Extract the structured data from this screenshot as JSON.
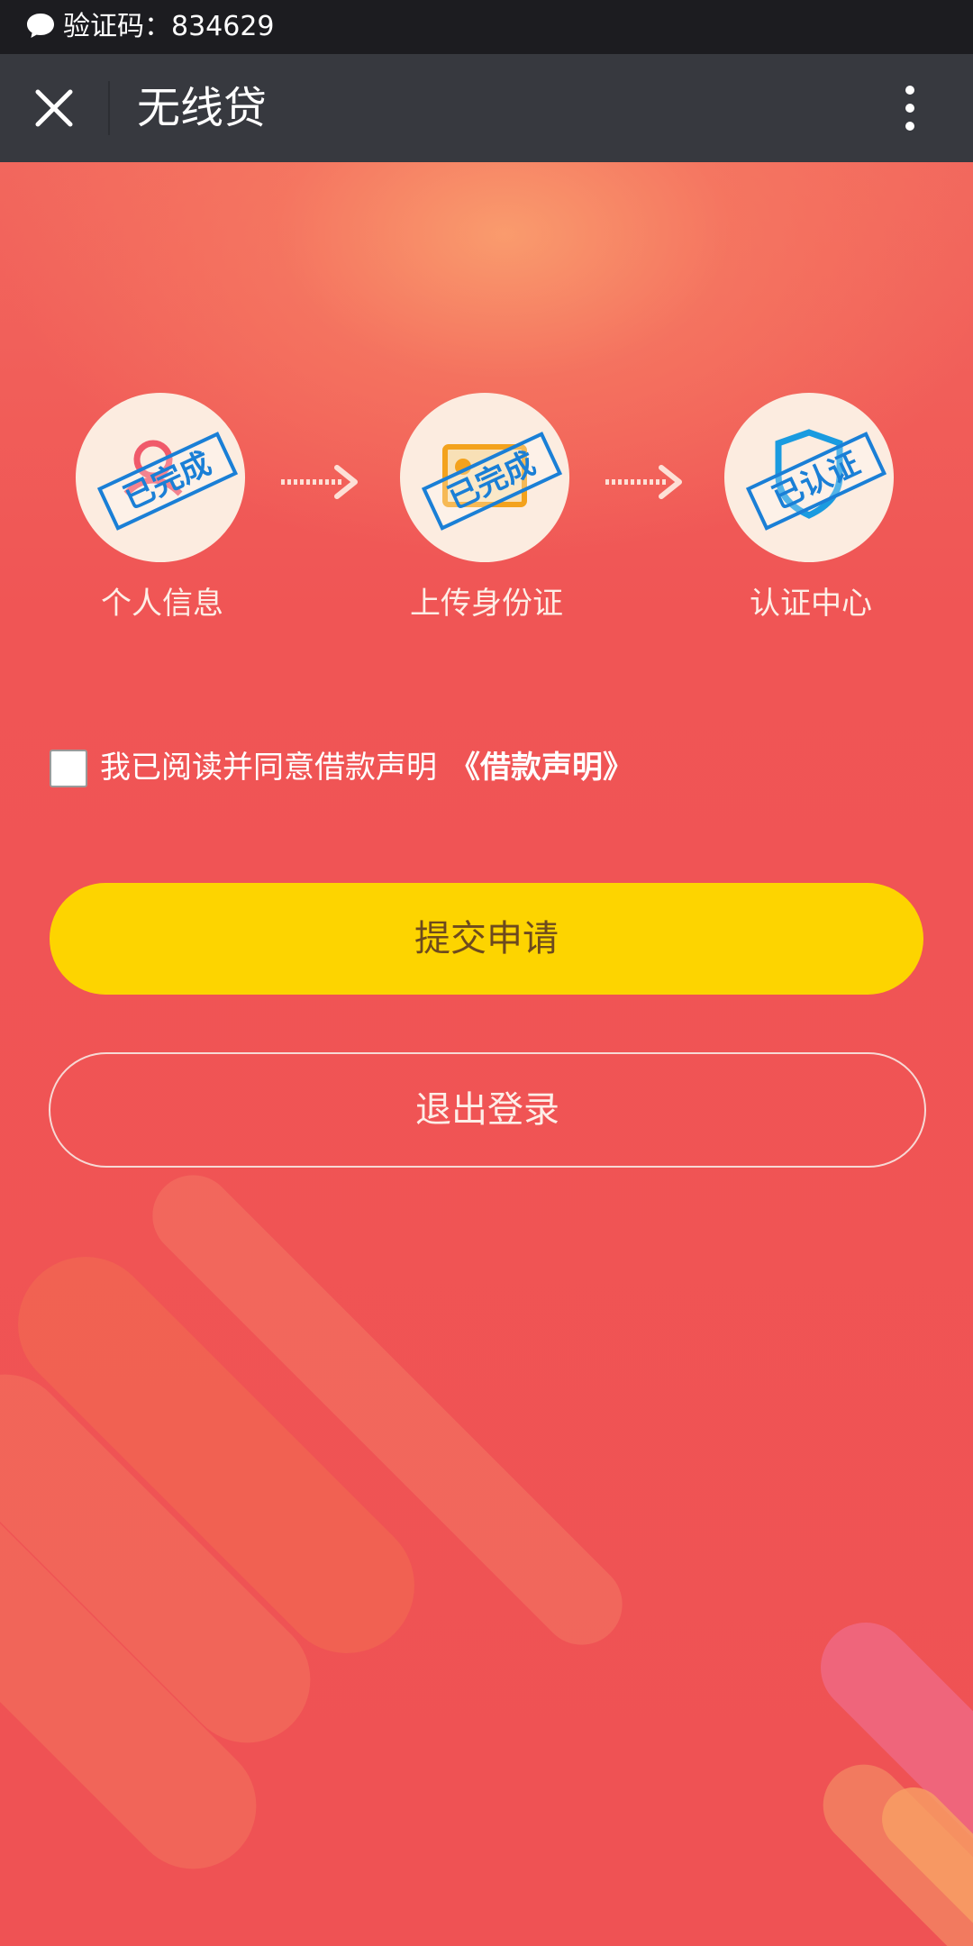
{
  "status_bar": {
    "notification_text": "验证码：834629",
    "icon": "chat-bubble-icon"
  },
  "navbar": {
    "title": "无线贷",
    "close_icon": "close-icon",
    "more_icon": "more-vertical-icon",
    "background": "#37393f"
  },
  "steps": [
    {
      "label": "个人信息",
      "stamp": "已完成",
      "icon": "person-pin-icon"
    },
    {
      "label": "上传身份证",
      "stamp": "已完成",
      "icon": "id-card-icon"
    },
    {
      "label": "认证中心",
      "stamp": "已认证",
      "icon": "shield-icon"
    }
  ],
  "agreement": {
    "text": "我已阅读并同意借款声明",
    "link_text": "《借款声明》",
    "checked": false
  },
  "buttons": {
    "submit_label": "提交申请",
    "logout_label": "退出登录"
  },
  "colors": {
    "background": "#f05656",
    "submit_button": "#fdd400",
    "stamp_blue": "#1a7fd6"
  }
}
